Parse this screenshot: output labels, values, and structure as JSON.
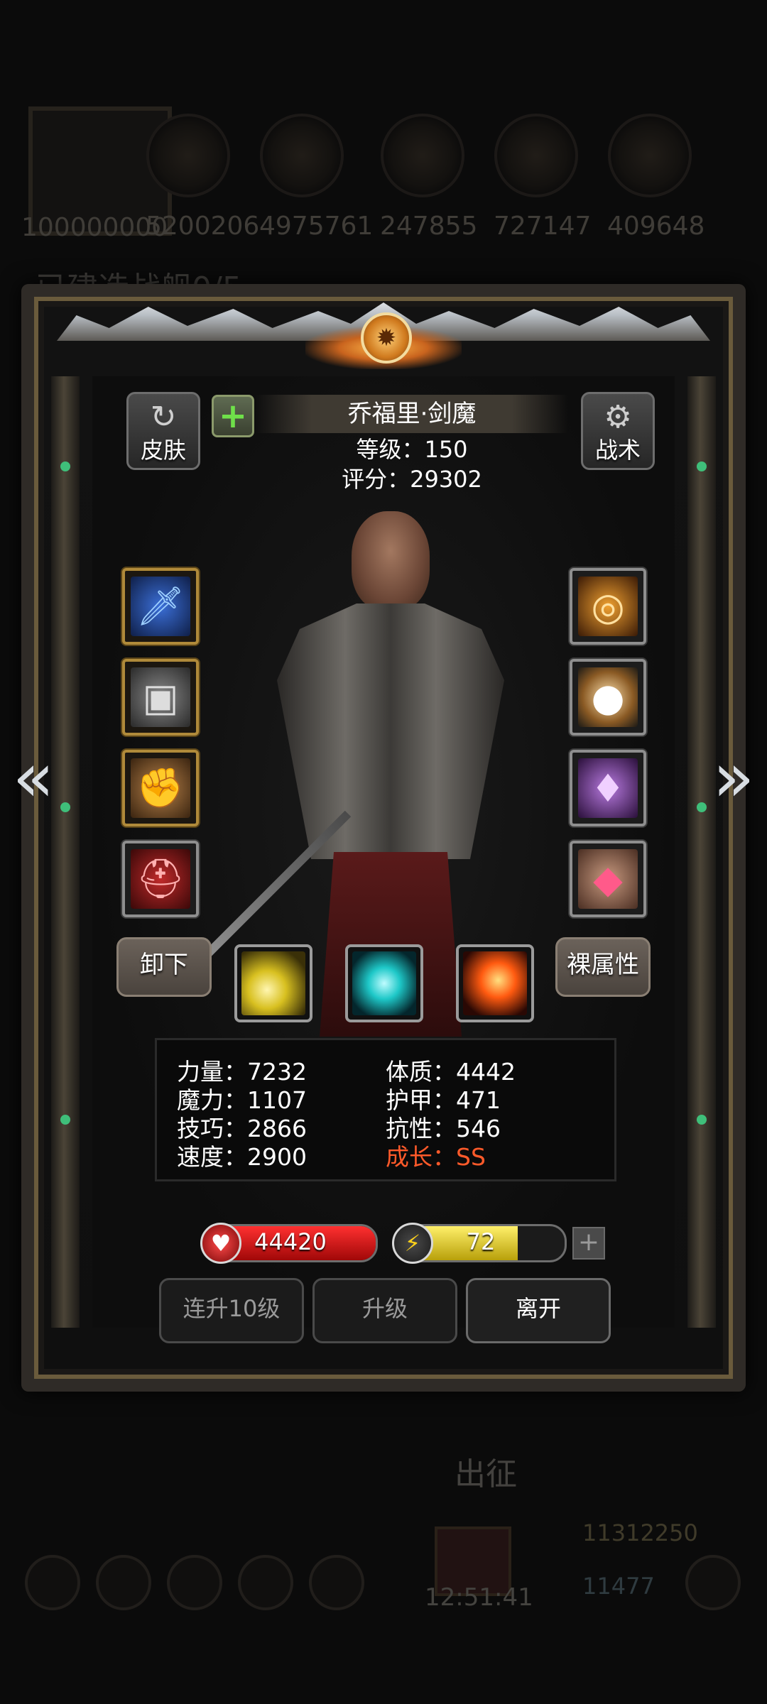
{
  "background": {
    "resources": [
      "100000000",
      "5200206",
      "4975761",
      "247855",
      "727147",
      "409648"
    ],
    "status_text": "已建造战舰0/5",
    "depart_label": "出征",
    "gold": "11312250",
    "gems": "11477",
    "clock": "12:51:41"
  },
  "header": {
    "skin_label": "皮肤",
    "tactic_label": "战术",
    "hero_name": "乔福里·剑魔",
    "level_text": "等级：150",
    "score_text": "评分：29302"
  },
  "equipment": {
    "left": [
      "sword-icon",
      "chest-armor-icon",
      "gauntlet-icon",
      "helmet-icon"
    ],
    "right": [
      "flame-ring-icon",
      "orb-icon",
      "lantern-icon",
      "amulet-icon"
    ]
  },
  "buttons": {
    "unequip_label": "卸下",
    "base_attr_label": "裸属性",
    "level_up_10_label": "连升10级",
    "level_up_label": "升级",
    "leave_label": "离开"
  },
  "skills": [
    "slash-light-icon",
    "wind-blade-icon",
    "fire-strike-icon"
  ],
  "stats": {
    "strength": "力量：7232",
    "magic": "魔力：1107",
    "skill": "技巧：2866",
    "speed": "速度：2900",
    "constitution": "体质：4442",
    "armor": "护甲：471",
    "resistance": "抗性：546",
    "growth_label": "成长：",
    "growth_value": "SS"
  },
  "bars": {
    "hp_value": "44420",
    "energy_value": "72",
    "energy_fraction": 0.72
  },
  "colors": {
    "accent_gold": "#b08a3a",
    "hp_red": "#d01818",
    "energy_yellow": "#e5d21a",
    "growth_red": "#ff5a2a"
  }
}
